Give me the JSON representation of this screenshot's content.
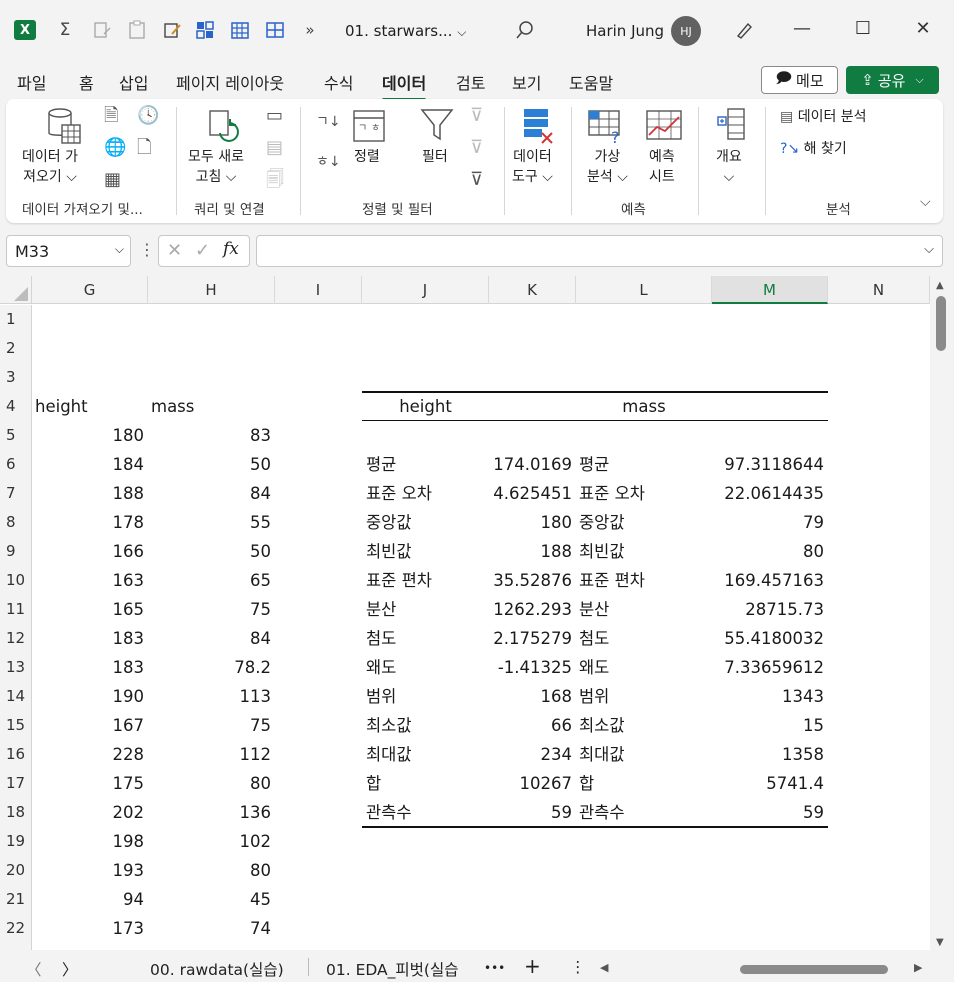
{
  "titlebar": {
    "logo_letter": "X",
    "overflow_glyph": "»",
    "doc_title": "01. starwars...",
    "user_name": "Harin Jung",
    "avatar_initials": "HJ"
  },
  "menu": {
    "tabs": [
      "파일",
      "홈",
      "삽입",
      "페이지 레이아웃",
      "수식",
      "데이터",
      "검토",
      "보기",
      "도움말"
    ],
    "active_tab": "데이터",
    "memo_label": "메모",
    "share_label": "공유"
  },
  "ribbon": {
    "get_data": {
      "line1": "데이터 가",
      "line2": "져오기"
    },
    "group1_label": "데이터 가져오기 및...",
    "refresh": {
      "line1": "모두 새로",
      "line2": "고침"
    },
    "group2_label": "쿼리 및 연결",
    "sort_label": "정렬",
    "filter_label": "필터",
    "group3_label": "정렬 및 필터",
    "data_tools": {
      "line1": "데이터",
      "line2": "도구"
    },
    "whatif": {
      "line1": "가상",
      "line2": "분석"
    },
    "forecast": {
      "line1": "예측",
      "line2": "시트"
    },
    "group4_label": "예측",
    "outline_label": "개요",
    "data_analysis": "데이터 분석",
    "solver": "해 찾기",
    "group5_label": "분석"
  },
  "formula_bar": {
    "name_box": "M33",
    "formula": ""
  },
  "grid": {
    "columns": [
      "G",
      "H",
      "I",
      "J",
      "K",
      "L",
      "M",
      "N"
    ],
    "selected_column": "M",
    "rows": [
      "1",
      "2",
      "3",
      "4",
      "5",
      "6",
      "7",
      "8",
      "9",
      "10",
      "11",
      "12",
      "13",
      "14",
      "15",
      "16",
      "17",
      "18",
      "19",
      "20",
      "21",
      "22"
    ],
    "raw_headers": {
      "height": "height",
      "mass": "mass"
    },
    "raw_data": [
      [
        "180",
        "83"
      ],
      [
        "184",
        "50"
      ],
      [
        "188",
        "84"
      ],
      [
        "178",
        "55"
      ],
      [
        "166",
        "50"
      ],
      [
        "163",
        "65"
      ],
      [
        "165",
        "75"
      ],
      [
        "183",
        "84"
      ],
      [
        "183",
        "78.2"
      ],
      [
        "190",
        "113"
      ],
      [
        "167",
        "75"
      ],
      [
        "228",
        "112"
      ],
      [
        "175",
        "80"
      ],
      [
        "202",
        "136"
      ],
      [
        "198",
        "102"
      ],
      [
        "193",
        "80"
      ],
      [
        "94",
        "45"
      ],
      [
        "173",
        "74"
      ]
    ],
    "stats_headers": {
      "height": "height",
      "mass": "mass"
    },
    "stats": [
      [
        "평균",
        "174.0169",
        "평균",
        "97.3118644"
      ],
      [
        "표준 오차",
        "4.625451",
        "표준 오차",
        "22.0614435"
      ],
      [
        "중앙값",
        "180",
        "중앙값",
        "79"
      ],
      [
        "최빈값",
        "188",
        "최빈값",
        "80"
      ],
      [
        "표준 편차",
        "35.52876",
        "표준 편차",
        "169.457163"
      ],
      [
        "분산",
        "1262.293",
        "분산",
        "28715.73"
      ],
      [
        "첨도",
        "2.175279",
        "첨도",
        "55.4180032"
      ],
      [
        "왜도",
        "-1.41325",
        "왜도",
        "7.33659612"
      ],
      [
        "범위",
        "168",
        "범위",
        "1343"
      ],
      [
        "최소값",
        "66",
        "최소값",
        "15"
      ],
      [
        "최대값",
        "234",
        "최대값",
        "1358"
      ],
      [
        "합",
        "10267",
        "합",
        "5741.4"
      ],
      [
        "관측수",
        "59",
        "관측수",
        "59"
      ]
    ]
  },
  "sheet_tabs": {
    "tab1": "00. rawdata(실습)",
    "tab2": "01. EDA_피벗(실습",
    "more": "•••",
    "add": "+"
  }
}
